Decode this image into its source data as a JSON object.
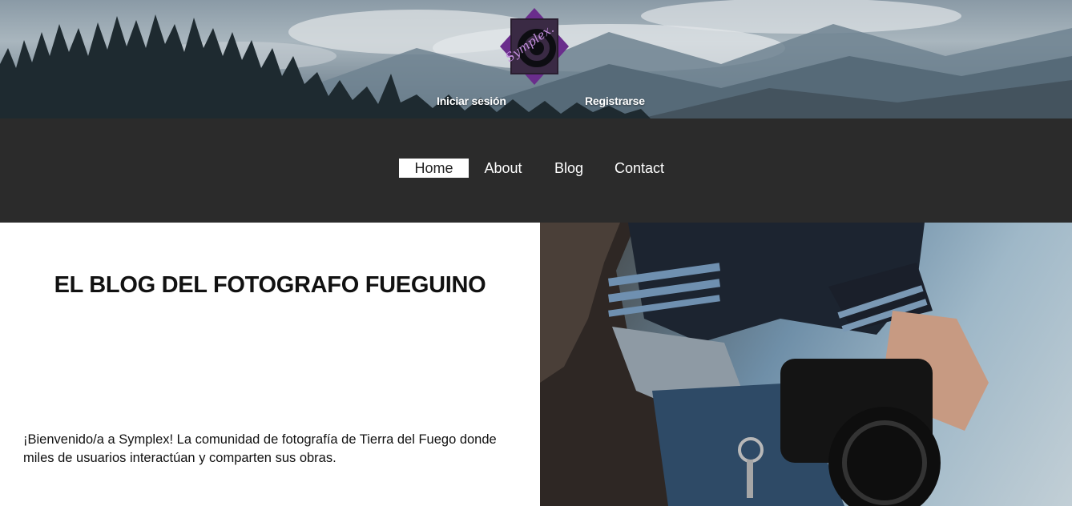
{
  "header": {
    "logo_text": "Symplex.",
    "login_label": "Iniciar sesión",
    "register_label": "Registrarse"
  },
  "nav": {
    "items": [
      {
        "label": "Home",
        "active": true
      },
      {
        "label": "About",
        "active": false
      },
      {
        "label": "Blog",
        "active": false
      },
      {
        "label": "Contact",
        "active": false
      }
    ]
  },
  "main": {
    "title": "EL BLOG DEL FOTOGRAFO FUEGUINO",
    "welcome": "¡Bienvenido/a a Symplex! La comunidad de fotografía de Tierra del Fuego donde miles de usuarios interactúan y comparten sus obras."
  },
  "colors": {
    "nav_bg": "#2b2b2b",
    "logo_purple": "#6a2d8c",
    "text_dark": "#111111"
  }
}
